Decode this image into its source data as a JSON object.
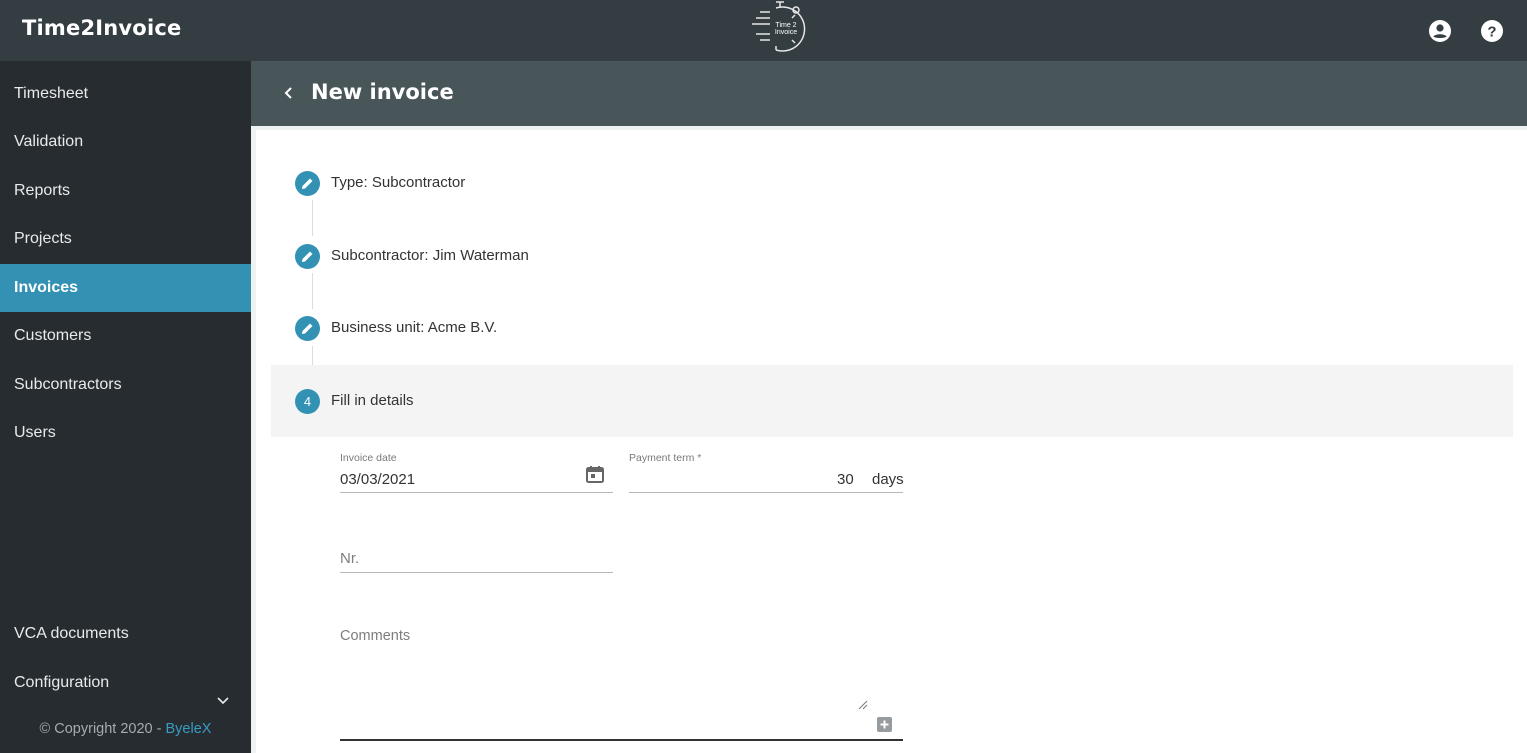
{
  "app": {
    "title": "Time2Invoice",
    "logo_text_line1": "Time 2",
    "logo_text_line2": "Invoice",
    "icons": [
      "account-circle-icon",
      "help-circle-icon"
    ]
  },
  "sidebar": {
    "items": [
      {
        "label": "Timesheet"
      },
      {
        "label": "Validation"
      },
      {
        "label": "Reports"
      },
      {
        "label": "Projects"
      },
      {
        "label": "Invoices",
        "active": true
      },
      {
        "label": "Customers"
      },
      {
        "label": "Subcontractors"
      },
      {
        "label": "Users"
      }
    ],
    "bottom_items": [
      {
        "label": "VCA documents"
      },
      {
        "label": "Configuration",
        "icon": "chevron-down-icon"
      }
    ],
    "copyright": "© Copyright 2020 - ",
    "copyright_link": "ByeleX"
  },
  "header": {
    "title": "New invoice",
    "back_icon": "chevron-left-icon"
  },
  "steps": [
    {
      "label": "Type: Subcontractor",
      "icon": "pencil-icon"
    },
    {
      "label": "Subcontractor: Jim Waterman",
      "icon": "pencil-icon"
    },
    {
      "label": "Business unit: Acme B.V.",
      "icon": "pencil-icon"
    },
    {
      "label": "Fill in details",
      "number": "4",
      "current": true
    }
  ],
  "form": {
    "invoice_date": {
      "label": "Invoice date",
      "value": "03/03/2021",
      "icon": "calendar-icon"
    },
    "payment_term": {
      "label": "Payment term *",
      "value": "30",
      "suffix": "days"
    },
    "nr": {
      "placeholder": "Nr."
    },
    "comments": {
      "placeholder": "Comments",
      "add_icon": "plus-box-icon"
    }
  },
  "colors": {
    "accent": "#3391b3",
    "topbar": "#343d41",
    "sidebar": "#262c30",
    "page_header": "#485559"
  }
}
